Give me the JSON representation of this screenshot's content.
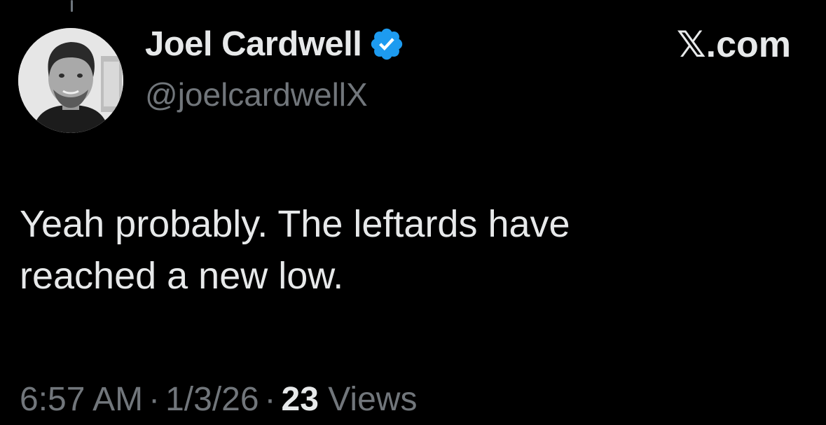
{
  "author": {
    "display_name": "Joel Cardwell",
    "handle": "@joelcardwellX",
    "verified": true,
    "verified_color": "#1d9bf0",
    "avatar_icon": "profile-photo"
  },
  "brand": {
    "label": "𝕏.com"
  },
  "tweet": {
    "line1": "Yeah probably. The leftards have",
    "line2": "reached a new low."
  },
  "meta": {
    "time": "6:57 AM",
    "separator": "·",
    "date": "1/3/26",
    "views_count": "23",
    "views_label": "Views"
  },
  "colors": {
    "background": "#000000",
    "primary_text": "#e7e9ea",
    "secondary_text": "#71767b"
  }
}
